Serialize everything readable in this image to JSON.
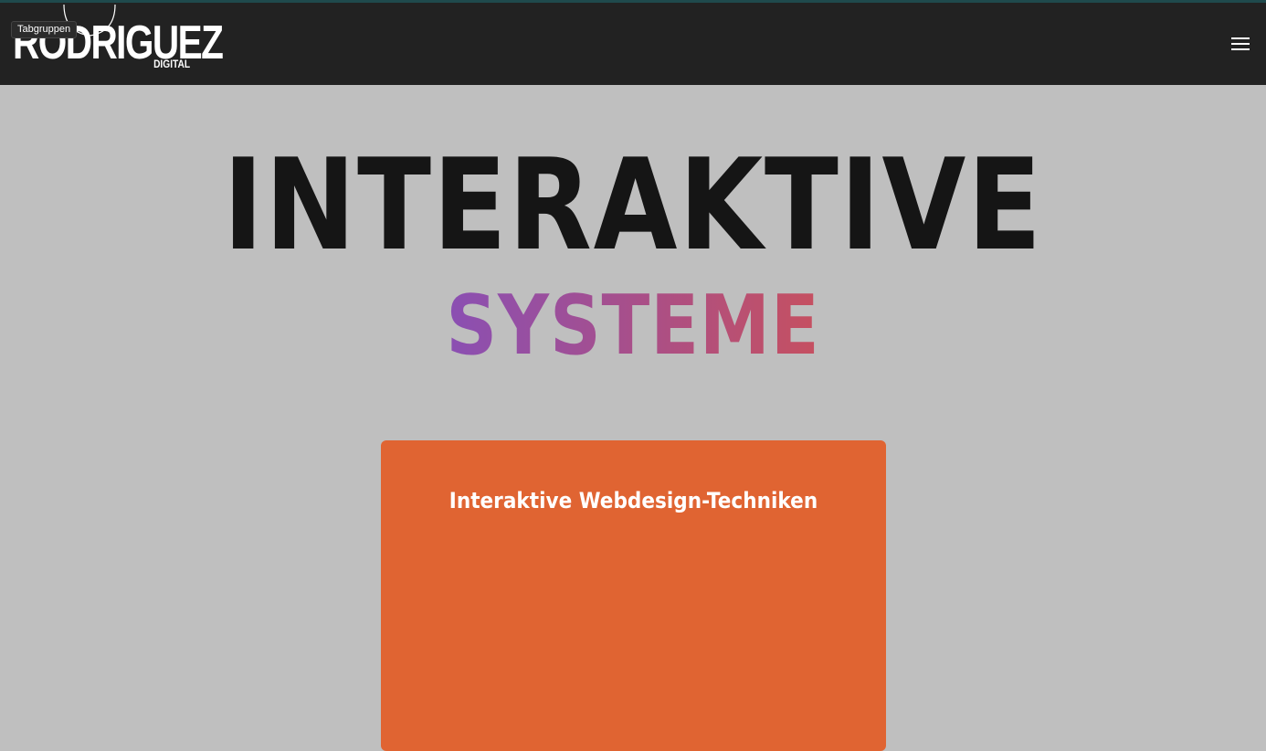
{
  "header": {
    "logo_text": "RODRIGUEZ",
    "logo_subtext": "DIGITAL",
    "tooltip": "Tabgruppen",
    "menu_icon": "hamburger-menu-icon"
  },
  "hero": {
    "title": "INTERAKTIVE",
    "subtitle": "SYSTEME"
  },
  "card": {
    "title": "Interaktive Webdesign-Techniken"
  },
  "colors": {
    "navbar": "#222222",
    "background": "#bfbfbf",
    "card": "#e06432",
    "title": "#151515",
    "subtitle_gradient_start": "#8a4fb3",
    "subtitle_gradient_end": "#c65060"
  }
}
